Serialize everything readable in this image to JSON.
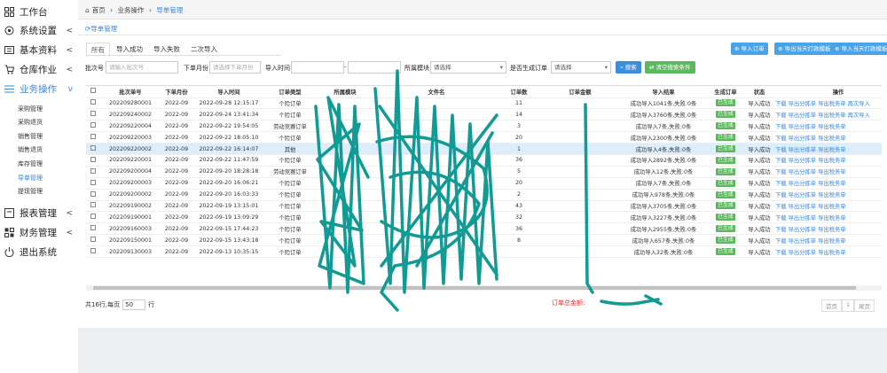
{
  "sidebar": {
    "items": [
      {
        "label": "工作台",
        "icon": "grid-icon",
        "chevron": ""
      },
      {
        "label": "系统设置",
        "icon": "gear-icon",
        "chevron": "<"
      },
      {
        "label": "基本资料",
        "icon": "profile-icon",
        "chevron": "<"
      },
      {
        "label": "仓库作业",
        "icon": "cart-icon",
        "chevron": "<"
      },
      {
        "label": "业务操作",
        "icon": "list-icon",
        "chevron": "v"
      },
      {
        "label": "报表管理",
        "icon": "report-icon",
        "chevron": "<"
      },
      {
        "label": "财务管理",
        "icon": "finance-icon",
        "chevron": "<"
      },
      {
        "label": "退出系统",
        "icon": "power-icon",
        "chevron": ""
      }
    ],
    "sub_items": [
      "采购管理",
      "采购退货",
      "销售管理",
      "销售退货",
      "库存管理",
      "导单管理",
      "提现管理"
    ]
  },
  "breadcrumb": {
    "home": "首页",
    "sep": "›",
    "level1": "业务操作",
    "level2": "导单管理"
  },
  "page_title": "导单管理",
  "tabs": [
    "所有",
    "导入成功",
    "导入失败",
    "二次导入"
  ],
  "toolbar": {
    "import_order": "导入订单",
    "export_payment": "导出当天打款模板",
    "import_payment": "导入当天打款模板"
  },
  "filters": {
    "batch_label": "批次号",
    "batch_placeholder": "请输入批次号",
    "month_label": "下单月份",
    "month_placeholder": "请选择下单月份",
    "import_time_label": "导入时间",
    "dash": "-",
    "module_label": "所属模块",
    "module_value": "请选择",
    "generated_label": "是否生成订单",
    "generated_value": "请选择",
    "search_btn": "搜索",
    "clear_btn": "清空搜索条件"
  },
  "table": {
    "headers": [
      "",
      "批次单号",
      "下单月份",
      "导入时间",
      "订单类型",
      "所属模块",
      "文件名",
      "订单数",
      "订单金额",
      "导入结果",
      "生成订单",
      "状态",
      "操作"
    ],
    "rows": [
      [
        "202209280001",
        "2022-09",
        "2022-09-28 12:15:17",
        "个险订单",
        "",
        "",
        "11",
        "",
        "成功导入1041条,失败:0条",
        "已生成",
        "导入成功",
        "下载 导出分拣单 导出税务单 再次导入"
      ],
      [
        "202209240002",
        "2022-09",
        "2022-09-24 13:41:34",
        "个险订单",
        "",
        "",
        "14",
        "",
        "成功导入3760条,失败:0条",
        "已生成",
        "导入成功",
        "下载 导出分拣单 导出税务单 再次导入"
      ],
      [
        "202209220004",
        "2022-09",
        "2022-09-22 19:54:05",
        "劳动竞赛订单",
        "",
        "",
        "3",
        "",
        "成功导入7条,失败:0条",
        "已生成",
        "导入成功",
        "下载 导出分拣单 导出税务单"
      ],
      [
        "202209220003",
        "2022-09",
        "2022-09-22 18:05:10",
        "个险订单",
        "",
        "",
        "20",
        "",
        "成功导入2300条,失败:0条",
        "已生成",
        "导入成功",
        "下载 导出分拣单 导出税务单"
      ],
      [
        "202209220002",
        "2022-09",
        "2022-09-22 16:14:07",
        "其他",
        "",
        "",
        "1",
        "",
        "成功导入4条,失败:0条",
        "已生成",
        "导入成功",
        "下载 导出分拣单 导出税务单"
      ],
      [
        "202209220001",
        "2022-09",
        "2022-09-22 11:47:59",
        "个险订单",
        "",
        "",
        "36",
        "",
        "成功导入2892条,失败:0条",
        "已生成",
        "导入成功",
        "下载 导出分拣单 导出税务单"
      ],
      [
        "202209200004",
        "2022-09",
        "2022-09-20 18:28:18",
        "劳动竞赛订单",
        "",
        "",
        "5",
        "",
        "成功导入12条,失败:0条",
        "已生成",
        "导入成功",
        "下载 导出分拣单 导出税务单"
      ],
      [
        "202209200003",
        "2022-09",
        "2022-09-20 16:06:21",
        "个险订单",
        "",
        "",
        "20",
        "",
        "成功导入7条,失败:0条",
        "已生成",
        "导入成功",
        "下载 导出分拣单 导出税务单"
      ],
      [
        "202209200002",
        "2022-09",
        "2022-09-20 16:03:33",
        "个险订单",
        "",
        "",
        "2",
        "",
        "成功导入978条,失败:0条",
        "已生成",
        "导入成功",
        "下载 导出分拣单 导出税务单"
      ],
      [
        "202209190002",
        "2022-09",
        "2022-09-19 13:15:01",
        "个险订单",
        "",
        "",
        "43",
        "",
        "成功导入3705条,失败:0条",
        "已生成",
        "导入成功",
        "下载 导出分拣单 导出税务单"
      ],
      [
        "202209190001",
        "2022-09",
        "2022-09-19 13:09:29",
        "个险订单",
        "",
        "",
        "32",
        "",
        "成功导入3227条,失败:0条",
        "已生成",
        "导入成功",
        "下载 导出分拣单 导出税务单"
      ],
      [
        "202209160003",
        "2022-09",
        "2022-09-15 17:44:23",
        "个险订单",
        "",
        "",
        "36",
        "",
        "成功导入2955条,失败:0条",
        "已生成",
        "导入成功",
        "下载 导出分拣单 导出税务单"
      ],
      [
        "202209150001",
        "2022-09",
        "2022-09-15 13:43:18",
        "个险订单",
        "",
        "",
        "8",
        "",
        "成功导入657条,失败:0条",
        "已生成",
        "导入成功",
        "下载 导出分拣单 导出税务单"
      ],
      [
        "202209130003",
        "2022-09",
        "2022-09-13 10:35:15",
        "个险订单",
        "",
        "",
        "",
        "",
        "成功导入32条,失败:0条",
        "已生成",
        "导入成功",
        "下载 导出分拣单 导出税务单"
      ]
    ]
  },
  "footer": {
    "prefix": "共16行,每页",
    "page_size": "50",
    "suffix": "行",
    "total_label": "订单总金额:",
    "first": "首页",
    "page": "1",
    "last": "尾页"
  },
  "colors": {
    "accent": "#3a87d8",
    "success": "#5cb85c",
    "danger": "#d9342b",
    "scribble": "#129a94"
  }
}
